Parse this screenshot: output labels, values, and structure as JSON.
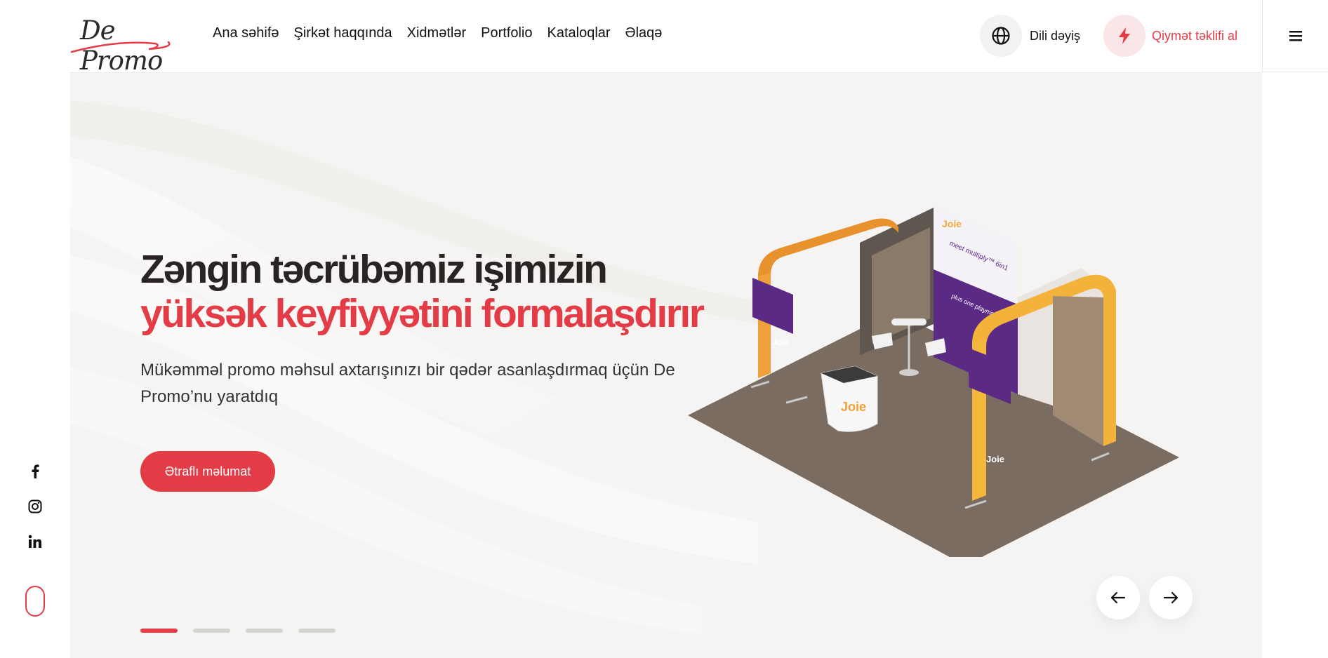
{
  "brand": {
    "logo_text": "De Promo"
  },
  "nav": {
    "items": [
      "Ana səhifə",
      "Şirkət haqqında",
      "Xidmətlər",
      "Portfolio",
      "Kataloqlar",
      "Əlaqə"
    ]
  },
  "header": {
    "language_label": "Dili dəyiş",
    "quote_label": "Qiymət təklifi al"
  },
  "hero": {
    "title_line1": "Zəngin təcrübəmiz işimizin",
    "title_line2": "yüksək keyfiyyətini formalaşdırır",
    "subtitle": "Mükəmməl promo məhsul axtarışınızı bir qədər asanlaşdırmaq üçün De Promo’nu yaratdıq",
    "cta_label": "Ətraflı məlumat",
    "image_texts": {
      "brand_mark": "Joie",
      "banner_headline": "meet multiply™ 6in1",
      "banner_subline": "plus one playmate"
    }
  },
  "slider": {
    "slide_count": 4,
    "active_index": 0
  },
  "social": [
    "facebook-icon",
    "instagram-icon",
    "linkedin-icon"
  ],
  "colors": {
    "accent": "#e33c46",
    "hero_bg": "#f5f4f2",
    "heading_dark": "#2a2323"
  }
}
